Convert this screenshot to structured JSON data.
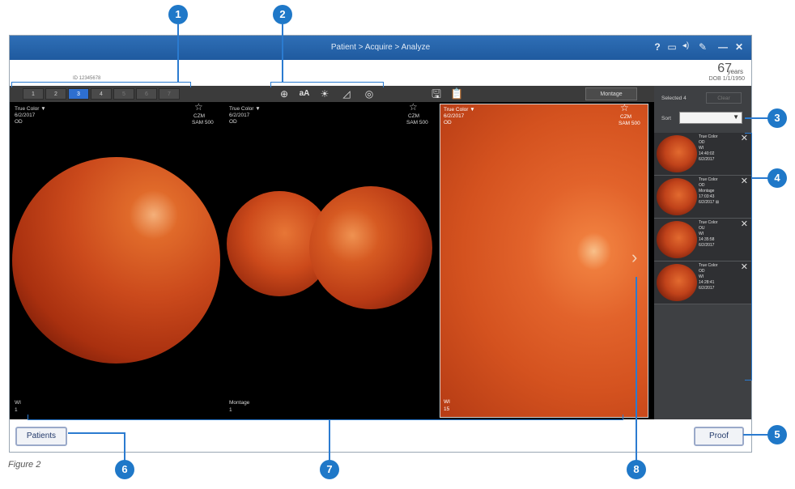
{
  "window": {
    "title": "Patient > Acquire > Analyze",
    "icons": [
      "help-icon",
      "maximize-icon",
      "speaker-icon",
      "wrench-icon",
      "minimize-icon",
      "close-icon"
    ]
  },
  "patient": {
    "id": "ID 12345678",
    "age": "67",
    "age_unit": "years",
    "dob": "DOB 1/1/1950"
  },
  "toolbar": {
    "pages": [
      "1",
      "2",
      "3",
      "4",
      "5",
      "6",
      "7"
    ],
    "selected_page": "3",
    "montage_label": "Montage",
    "tools": [
      "zoom-icon",
      "text-size-icon",
      "brightness-icon",
      "histogram-icon",
      "rotate-icon"
    ]
  },
  "panes": [
    {
      "mode": "True Color",
      "date": "6/2/2017",
      "eye": "OD",
      "device": "CZM",
      "model": "SAM 500",
      "type": "WI",
      "num": "1"
    },
    {
      "mode": "True Color",
      "date": "6/2/2017",
      "eye": "OD",
      "device": "CZM",
      "model": "SAM 500",
      "type": "Montage",
      "num": "1"
    },
    {
      "mode": "True Color",
      "date": "6/2/2017",
      "eye": "OD",
      "device": "CZM",
      "model": "SAM 500",
      "type": "WI",
      "num": "15"
    }
  ],
  "sidebar": {
    "selected_label": "Selected",
    "selected_count": "4",
    "clear_label": "Clear",
    "sort_label": "Sort",
    "thumbs": [
      {
        "l1": "True Color",
        "l2": "OD",
        "l3": "WI",
        "l4": "14:40:02",
        "l5": "6/2/2017"
      },
      {
        "l1": "True Color",
        "l2": "OD",
        "l3": "Montage",
        "l4": "17:03:43",
        "l5": "6/2/2017"
      },
      {
        "l1": "True Color",
        "l2": "OU",
        "l3": "WI",
        "l4": "14:35:58",
        "l5": "6/2/2017"
      },
      {
        "l1": "True Color",
        "l2": "OD",
        "l3": "WI",
        "l4": "14:28:41",
        "l5": "6/2/2017"
      }
    ]
  },
  "bottom": {
    "patients_label": "Patients",
    "proof_label": "Proof"
  },
  "caption": "Figure 2",
  "callouts": [
    "1",
    "2",
    "3",
    "4",
    "5",
    "6",
    "7",
    "8"
  ],
  "colors": {
    "titlebar": "#1f5a9f",
    "accent": "#2e6fd0",
    "callout": "#1f78c8"
  }
}
